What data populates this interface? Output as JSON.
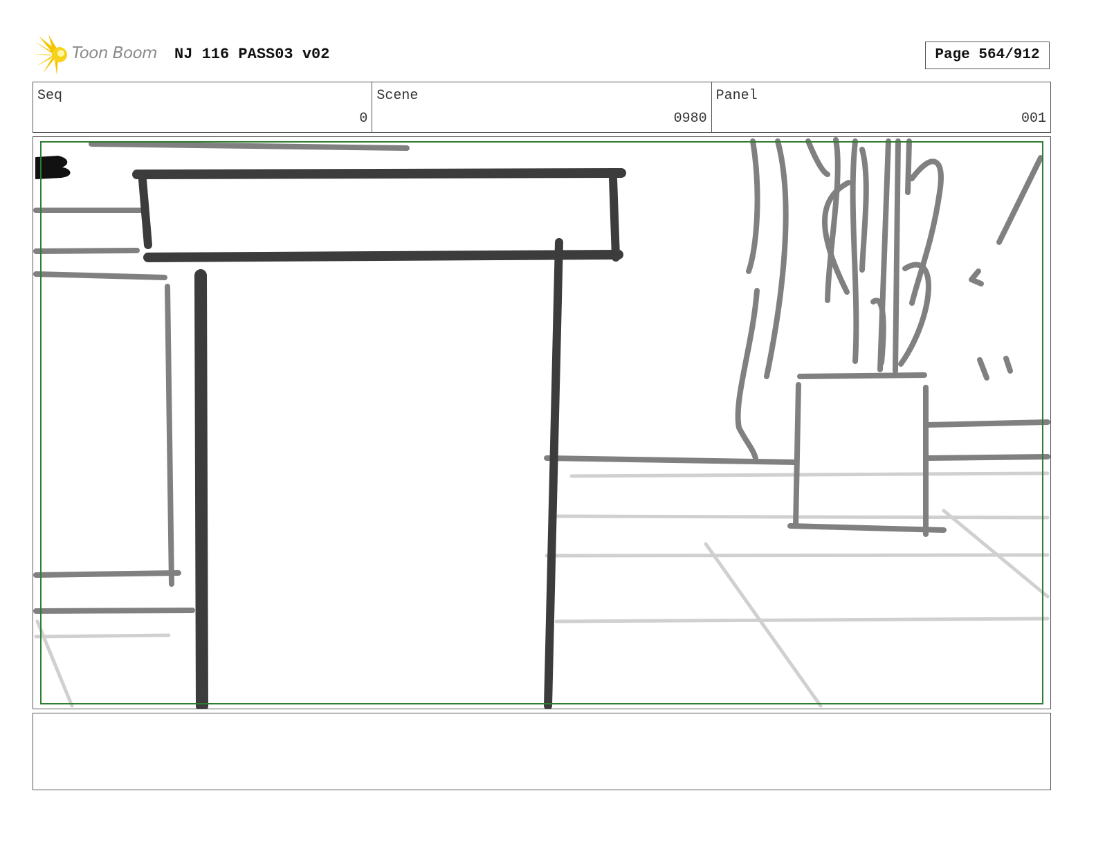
{
  "header": {
    "logo_text": "Toon Boom",
    "title": "NJ 116 PASS03 v02",
    "page": "Page 564/912"
  },
  "fields": {
    "seq_label": "Seq",
    "seq_value": "0",
    "scene_label": "Scene",
    "scene_value": "0980",
    "panel_label": "Panel",
    "panel_value": "001"
  },
  "panel": {
    "safe_frame_color": "#2e7d32",
    "stroke_dark": "#3a3a3a",
    "stroke_mid": "#7f7f7f",
    "stroke_light": "#cfcfcf"
  },
  "notes": ""
}
